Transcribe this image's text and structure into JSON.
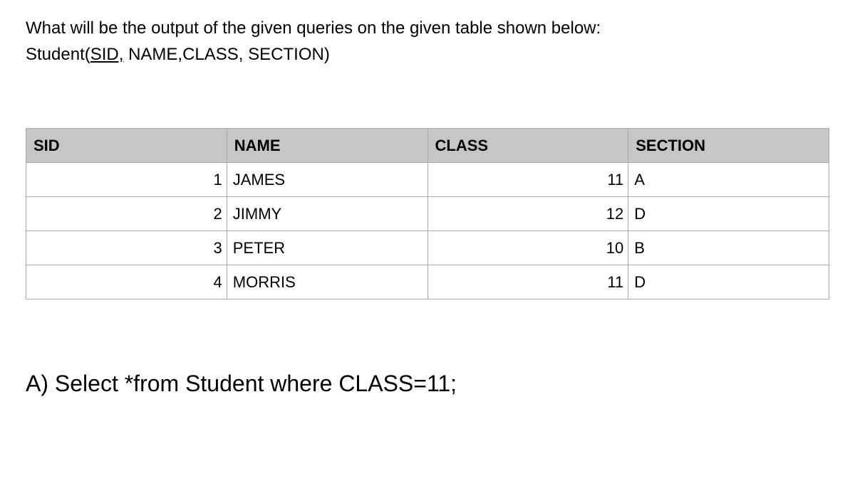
{
  "question": {
    "line1": "What will be the output of the given queries on the given table shown below:",
    "line2_prefix": "Student(",
    "line2_sid": "SID,",
    "line2_rest": " NAME,CLASS, SECTION)"
  },
  "table": {
    "headers": [
      "SID",
      "NAME",
      "CLASS",
      "SECTION"
    ],
    "rows": [
      {
        "sid": "1",
        "name": "JAMES",
        "class": "11",
        "section": "A"
      },
      {
        "sid": "2",
        "name": "JIMMY",
        "class": "12",
        "section": "D"
      },
      {
        "sid": "3",
        "name": "PETER",
        "class": "10",
        "section": "B"
      },
      {
        "sid": "4",
        "name": "MORRIS",
        "class": "11",
        "section": "D"
      }
    ]
  },
  "query": {
    "label": "A) Select *from Student where CLASS=11;"
  }
}
